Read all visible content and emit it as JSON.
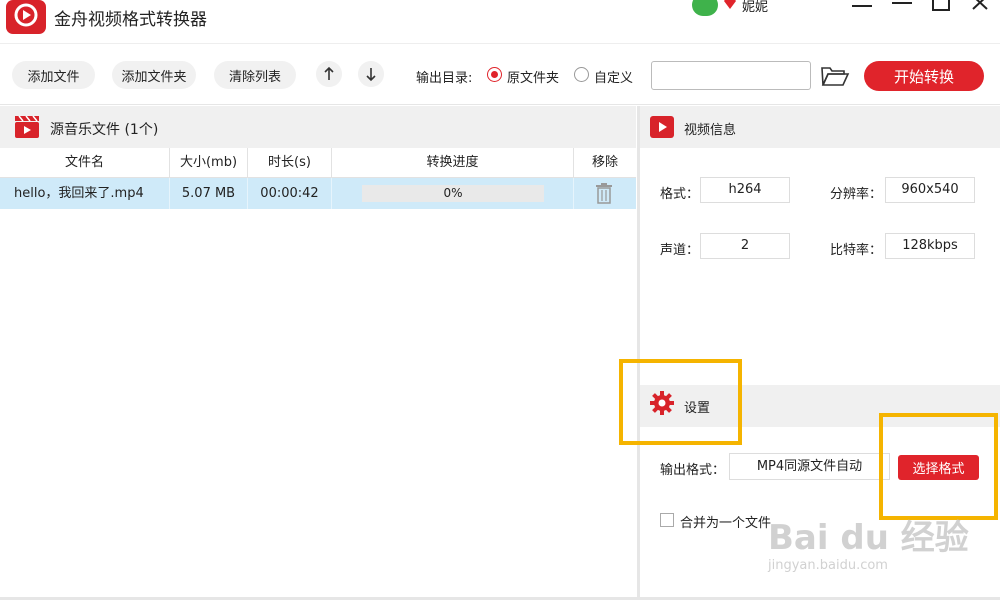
{
  "app": {
    "title": "金舟视频格式转换器",
    "user_name": "妮妮"
  },
  "toolbar": {
    "add_file": "添加文件",
    "add_folder": "添加文件夹",
    "clear_list": "清除列表",
    "output_dir_label": "输出目录:",
    "option_source": "原文件夹",
    "option_custom": "自定义",
    "path_value": "",
    "start": "开始转换"
  },
  "left": {
    "title": "源音乐文件 (1个)",
    "columns": [
      "文件名",
      "大小(mb)",
      "时长(s)",
      "转换进度",
      "移除"
    ],
    "rows": [
      {
        "name": "hello，我回来了.mp4",
        "size": "5.07 MB",
        "duration": "00:00:42",
        "progress": "0%"
      }
    ]
  },
  "video_info": {
    "title": "视频信息",
    "format_label": "格式：",
    "format": "h264",
    "resolution_label": "分辨率：",
    "resolution": "960x540",
    "channel_label": "声道：",
    "channel": "2",
    "bitrate_label": "比特率：",
    "bitrate": "128kbps"
  },
  "settings": {
    "title": "设置",
    "output_format_label": "输出格式：",
    "output_format": "MP4同源文件自动",
    "select_format": "选择格式",
    "merge_label": "合并为一个文件"
  },
  "watermark": {
    "brand": "Bai du 经验",
    "url": "jingyan.baidu.com"
  },
  "colors": {
    "accent": "#e0242b",
    "highlight": "#f5b400",
    "row_selected": "#cfeaf9"
  }
}
